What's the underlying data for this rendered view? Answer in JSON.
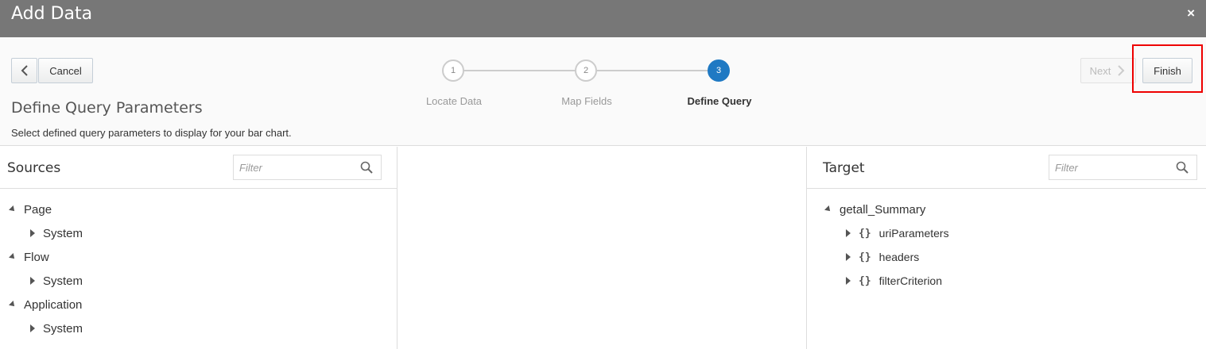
{
  "dialog": {
    "title": "Add Data",
    "close_glyph": "×"
  },
  "nav": {
    "back_glyph": "<",
    "cancel_label": "Cancel",
    "next_label": "Next",
    "next_glyph": ">",
    "finish_label": "Finish"
  },
  "steps": [
    {
      "number": "1",
      "label": "Locate Data",
      "state": "done"
    },
    {
      "number": "2",
      "label": "Map Fields",
      "state": "done"
    },
    {
      "number": "3",
      "label": "Define Query",
      "state": "active"
    }
  ],
  "page": {
    "title": "Define Query Parameters",
    "subtitle": "Select defined query parameters to display for your bar chart."
  },
  "sources": {
    "title": "Sources",
    "filter_placeholder": "Filter",
    "tree": [
      {
        "label": "Page",
        "expanded": true,
        "children": [
          {
            "label": "System"
          }
        ]
      },
      {
        "label": "Flow",
        "expanded": true,
        "children": [
          {
            "label": "System"
          }
        ]
      },
      {
        "label": "Application",
        "expanded": true,
        "children": [
          {
            "label": "System"
          }
        ]
      }
    ]
  },
  "target": {
    "title": "Target",
    "filter_placeholder": "Filter",
    "root": "getall_Summary",
    "children": [
      "uriParameters",
      "headers",
      "filterCriterion"
    ]
  },
  "colors": {
    "accent": "#1f79c3",
    "titlebar": "#777777",
    "highlight": "#e00000"
  }
}
